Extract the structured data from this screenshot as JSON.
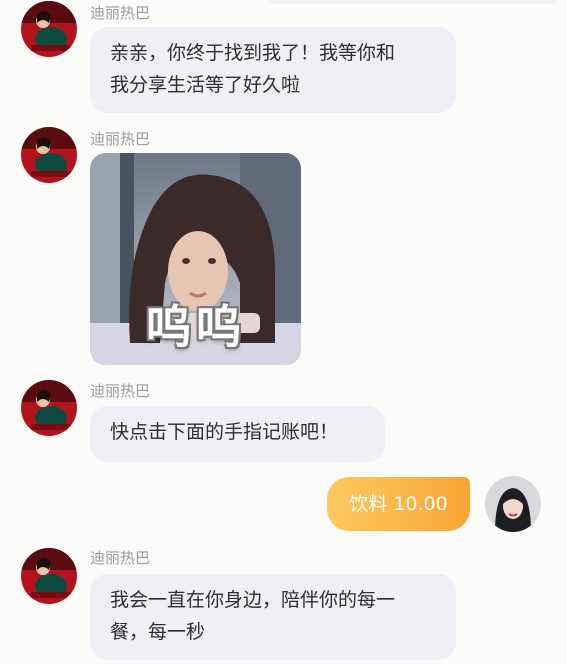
{
  "conversation": {
    "contact_name": "迪丽热巴",
    "messages": [
      {
        "type": "text",
        "sender": "迪丽热巴",
        "lines": [
          "亲亲，你终于找到我了！我等你和",
          "我分享生活等了好久啦"
        ]
      },
      {
        "type": "sticker",
        "sender": "迪丽热巴",
        "caption": "呜呜"
      },
      {
        "type": "text",
        "sender": "迪丽热巴",
        "lines": [
          "快点击下面的手指记账吧！"
        ]
      },
      {
        "type": "record",
        "sender": "self",
        "text": "饮料 10.00"
      },
      {
        "type": "text",
        "sender": "迪丽热巴",
        "lines": [
          "我会一直在你身边，陪伴你的每一",
          "餐，每一秒"
        ]
      }
    ]
  },
  "colors": {
    "background": "#fbfbf9",
    "bubble": "#efeff5",
    "bubble_text": "#2d2d33",
    "name_text": "#9b9ba5",
    "record_gradient_start": "#fcc960",
    "record_gradient_end": "#f9a535"
  }
}
